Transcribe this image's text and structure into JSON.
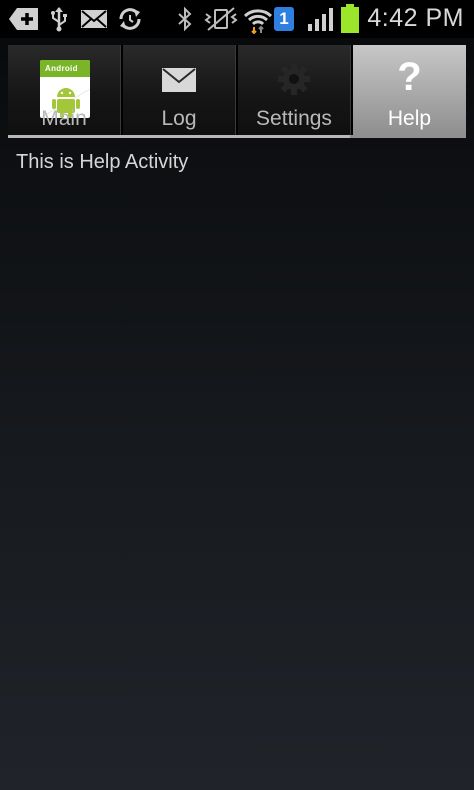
{
  "status_bar": {
    "time": "4:42 PM",
    "sim_slot": "1",
    "icons": [
      "add-icon",
      "usb-icon",
      "mail-icon",
      "sync-icon",
      "bluetooth-icon",
      "vibrate-icon",
      "wifi-icon",
      "sim-icon",
      "signal-icon",
      "battery-icon"
    ],
    "battery_color": "#9be52a"
  },
  "tabs": [
    {
      "label": "Main",
      "icon": "android-app-icon",
      "icon_text": "Android",
      "selected": false
    },
    {
      "label": "Log",
      "icon": "envelope-icon",
      "selected": false
    },
    {
      "label": "Settings",
      "icon": "gear-icon",
      "selected": false
    },
    {
      "label": "Help",
      "icon": "question-icon",
      "icon_glyph": "?",
      "selected": true
    }
  ],
  "content": {
    "text": "This is Help Activity"
  }
}
